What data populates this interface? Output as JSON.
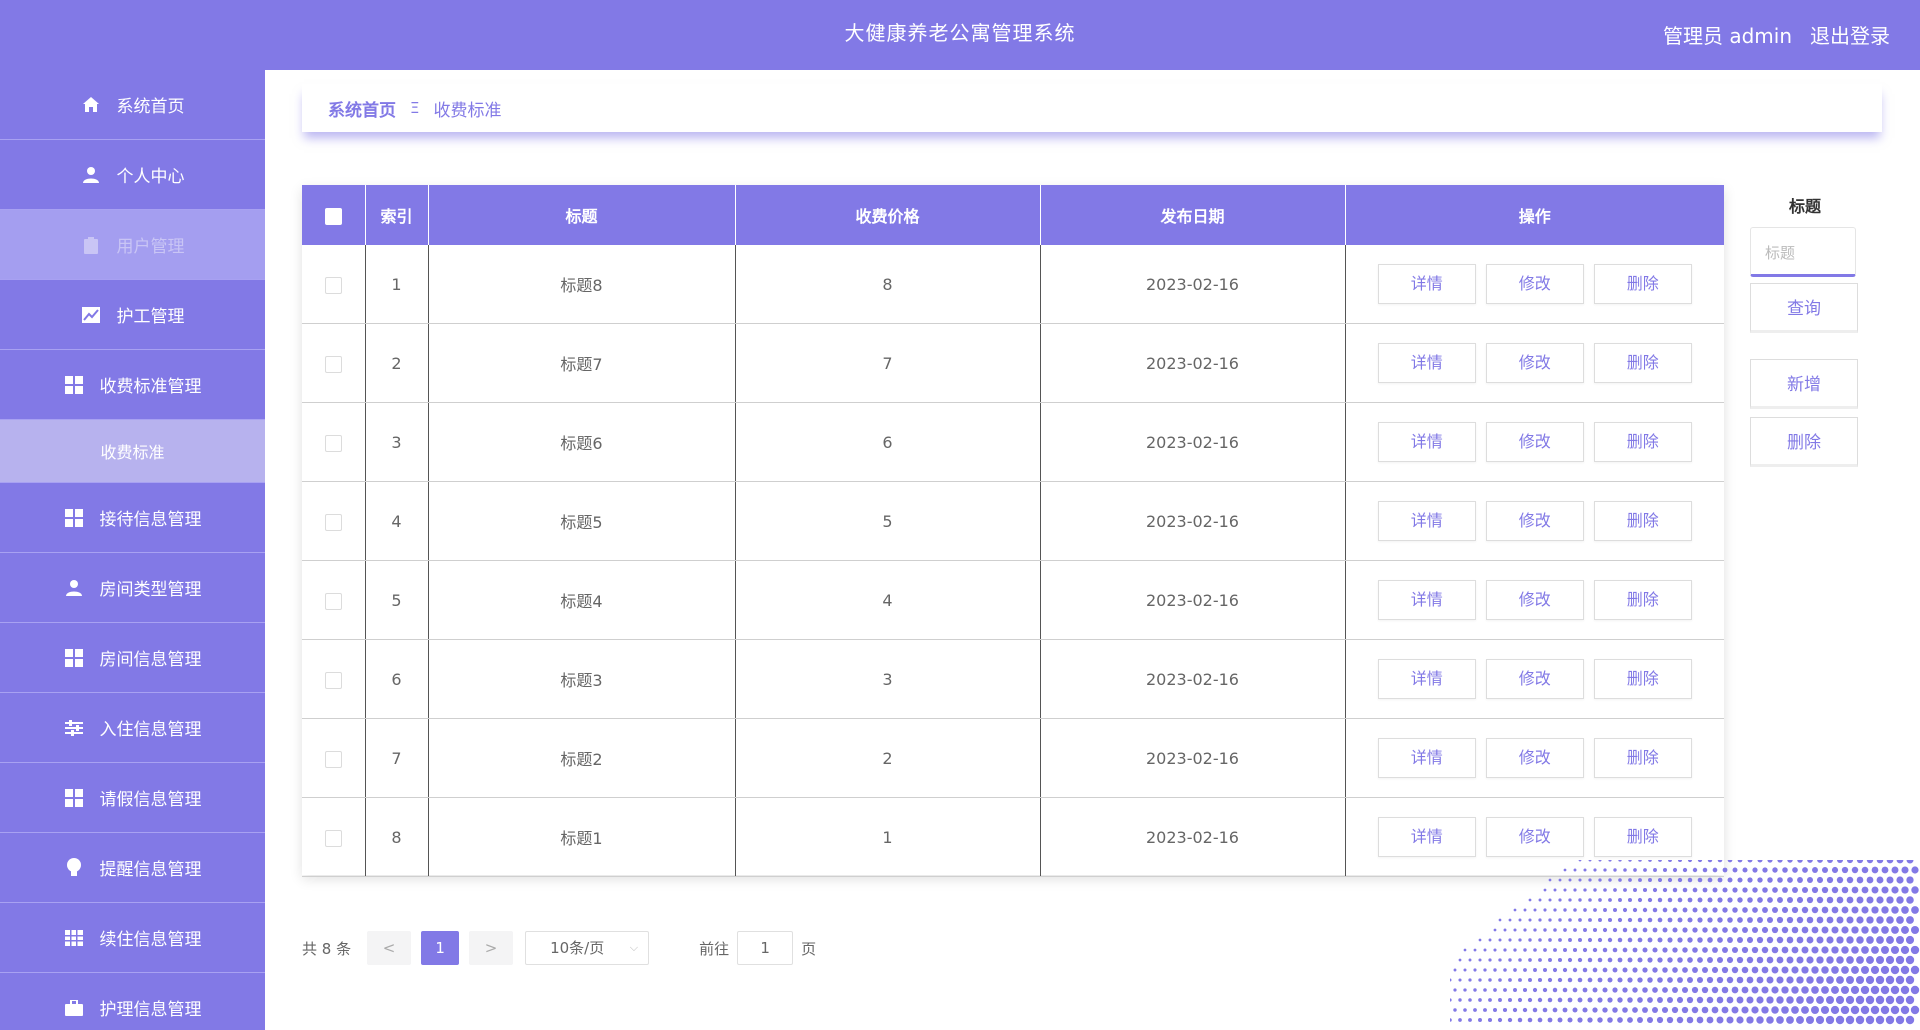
{
  "header": {
    "title": "大健康养老公寓管理系统",
    "user": "管理员 admin",
    "logout": "退出登录"
  },
  "colors": {
    "accent": "#8279e6",
    "accent_light": "#b7b2ee"
  },
  "sidebar": {
    "items": [
      {
        "label": "系统首页",
        "icon": "home-icon"
      },
      {
        "label": "个人中心",
        "icon": "user-icon"
      },
      {
        "label": "用户管理",
        "icon": "clipboard-icon"
      },
      {
        "label": "护工管理",
        "icon": "chart-icon"
      },
      {
        "label": "收费标准管理",
        "icon": "grid-icon"
      },
      {
        "label": "收费标准",
        "icon": ""
      },
      {
        "label": "接待信息管理",
        "icon": "grid-icon"
      },
      {
        "label": "房间类型管理",
        "icon": "user-icon"
      },
      {
        "label": "房间信息管理",
        "icon": "grid-icon"
      },
      {
        "label": "入住信息管理",
        "icon": "sliders-icon"
      },
      {
        "label": "请假信息管理",
        "icon": "grid-icon"
      },
      {
        "label": "提醒信息管理",
        "icon": "bulb-icon"
      },
      {
        "label": "续住信息管理",
        "icon": "table-icon"
      },
      {
        "label": "护理信息管理",
        "icon": "briefcase-icon"
      }
    ]
  },
  "breadcrumb": {
    "home": "系统首页",
    "separator": "Ξ",
    "current": "收费标准"
  },
  "table": {
    "headers": [
      "索引",
      "标题",
      "收费价格",
      "发布日期",
      "操作"
    ],
    "rows": [
      {
        "index": "1",
        "title": "标题8",
        "price": "8",
        "date": "2023-02-16"
      },
      {
        "index": "2",
        "title": "标题7",
        "price": "7",
        "date": "2023-02-16"
      },
      {
        "index": "3",
        "title": "标题6",
        "price": "6",
        "date": "2023-02-16"
      },
      {
        "index": "4",
        "title": "标题5",
        "price": "5",
        "date": "2023-02-16"
      },
      {
        "index": "5",
        "title": "标题4",
        "price": "4",
        "date": "2023-02-16"
      },
      {
        "index": "6",
        "title": "标题3",
        "price": "3",
        "date": "2023-02-16"
      },
      {
        "index": "7",
        "title": "标题2",
        "price": "2",
        "date": "2023-02-16"
      },
      {
        "index": "8",
        "title": "标题1",
        "price": "1",
        "date": "2023-02-16"
      }
    ],
    "actions": {
      "detail": "详情",
      "edit": "修改",
      "delete": "删除"
    }
  },
  "search": {
    "label": "标题",
    "placeholder": "标题",
    "query": "查询",
    "add": "新增",
    "delete": "删除"
  },
  "pagination": {
    "total": "共 8 条",
    "prev": "<",
    "page": "1",
    "next": ">",
    "size": "10条/页",
    "goto": "前往",
    "goto_value": "1",
    "page_unit": "页"
  }
}
